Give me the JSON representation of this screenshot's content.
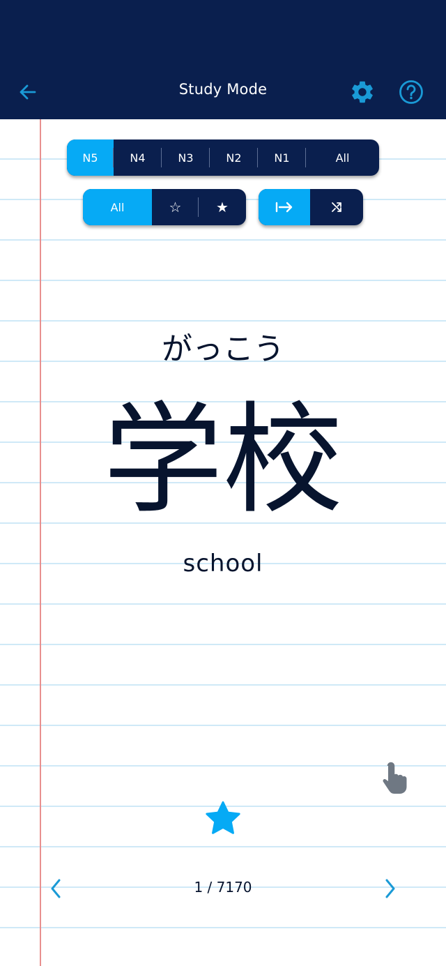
{
  "header": {
    "title": "Study Mode",
    "back_icon": "arrow-left-icon",
    "settings_icon": "gear-icon",
    "help_icon": "question-circle-icon"
  },
  "colors": {
    "header_bg": "#0a1f4e",
    "accent": "#06aaf5",
    "segment_bg": "#0a1f4e",
    "text": "#07142e",
    "rule_line": "#cfe9f7",
    "margin_line": "#e8908f"
  },
  "jlpt_levels": {
    "options": [
      "N5",
      "N4",
      "N3",
      "N2",
      "N1",
      "All"
    ],
    "selected": "N5"
  },
  "star_filter": {
    "options": [
      "All",
      "☆",
      "★"
    ],
    "selected": "All"
  },
  "order": {
    "options": [
      "sequential-icon",
      "shuffle-icon"
    ],
    "selected": "sequential-icon"
  },
  "card": {
    "reading": "がっこう",
    "kanji": "学校",
    "meaning": "school"
  },
  "tap_hint_icon": "tap-hand-icon",
  "favorite_icon": "star-filled-icon",
  "pager": {
    "counter": "1 / 7170",
    "prev_icon": "chevron-left-icon",
    "next_icon": "chevron-right-icon"
  }
}
